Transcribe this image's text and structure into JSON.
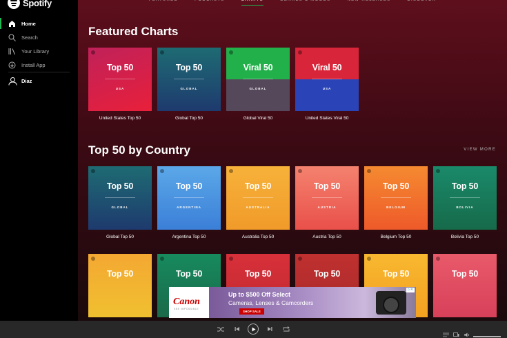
{
  "app": {
    "name": "Spotify"
  },
  "sidebar": {
    "items": [
      {
        "label": "Home",
        "icon": "home-icon",
        "active": true
      },
      {
        "label": "Search",
        "icon": "search-icon",
        "active": false
      },
      {
        "label": "Your Library",
        "icon": "library-icon",
        "active": false
      },
      {
        "label": "Install App",
        "icon": "download-icon",
        "active": false
      }
    ],
    "user": {
      "label": "Diaz",
      "icon": "user-icon"
    }
  },
  "topnav": {
    "tabs": [
      {
        "label": "FEATURED",
        "active": false
      },
      {
        "label": "PODCASTS",
        "active": false
      },
      {
        "label": "CHARTS",
        "active": true
      },
      {
        "label": "GENRES & MOODS",
        "active": false
      },
      {
        "label": "NEW RELEASES",
        "active": false
      },
      {
        "label": "DISCOVER",
        "active": false
      }
    ]
  },
  "featured": {
    "title": "Featured Charts",
    "cards": [
      {
        "big": "Top 50",
        "sub": "USA",
        "name": "United States Top 50",
        "bg": "linear-gradient(160deg,#c0215a,#e8203a)"
      },
      {
        "big": "Top 50",
        "sub": "GLOBAL",
        "name": "Global Top 50",
        "bg": "linear-gradient(180deg,#1e6b73,#1e3a6e)"
      },
      {
        "big": "Viral 50",
        "sub": "GLOBAL",
        "name": "Global Viral 50",
        "bg": "linear-gradient(180deg,#22b04a 0%,#22b04a 50%,#55485a 50%,#55485a 100%)"
      },
      {
        "big": "Viral 50",
        "sub": "USA",
        "name": "United States Viral 50",
        "bg": "linear-gradient(180deg,#d8253a 0%,#d8253a 50%,#2a44b8 50%,#2a44b8 100%)"
      }
    ]
  },
  "by_country": {
    "title": "Top 50 by Country",
    "view_more": "VIEW MORE",
    "cards": [
      {
        "big": "Top 50",
        "sub": "GLOBAL",
        "name": "Global Top 50",
        "bg": "linear-gradient(180deg,#1e6b73,#1e3a6e)"
      },
      {
        "big": "Top 50",
        "sub": "ARGENTINA",
        "name": "Argentina Top 50",
        "bg": "linear-gradient(180deg,#5ba8e8,#3b7fd8)"
      },
      {
        "big": "Top 50",
        "sub": "AUSTRALIA",
        "name": "Australia Top 50",
        "bg": "linear-gradient(180deg,#f7b23a,#f09a2a)"
      },
      {
        "big": "Top 50",
        "sub": "AUSTRIA",
        "name": "Austria Top 50",
        "bg": "linear-gradient(180deg,#f4826e,#e9504a)"
      },
      {
        "big": "Top 50",
        "sub": "BELGIUM",
        "name": "Belgium Top 50",
        "bg": "linear-gradient(180deg,#f58a30,#ee5a2a)"
      },
      {
        "big": "Top 50",
        "sub": "BOLIVIA",
        "name": "Bolivia Top 50",
        "bg": "linear-gradient(180deg,#1a8a6a,#166a4a)"
      }
    ],
    "row3": [
      {
        "big": "Top 50",
        "bg": "linear-gradient(180deg,#f4a832,#f0c030)"
      },
      {
        "big": "Top 50",
        "bg": "linear-gradient(180deg,#178a5e,#1a6a4a)"
      },
      {
        "big": "Top 50",
        "bg": "linear-gradient(180deg,#d8303a,#c02a30)"
      },
      {
        "big": "Top 50",
        "bg": "linear-gradient(180deg,#c03030,#a82a2a)"
      },
      {
        "big": "Top 50",
        "bg": "linear-gradient(180deg,#f8b830,#f4a020)"
      },
      {
        "big": "Top 50",
        "bg": "linear-gradient(180deg,#e85a6a,#d8405a)"
      }
    ]
  },
  "ad": {
    "brand": "Canon",
    "tagline": "SEE IMPOSSIBLE",
    "headline": "Up to $500 Off Select",
    "subline": "Cameras, Lenses & Camcorders",
    "button": "SHOP SALE"
  },
  "colors": {
    "accent": "#1db954",
    "sidebar": "#000000",
    "player": "#282828"
  }
}
